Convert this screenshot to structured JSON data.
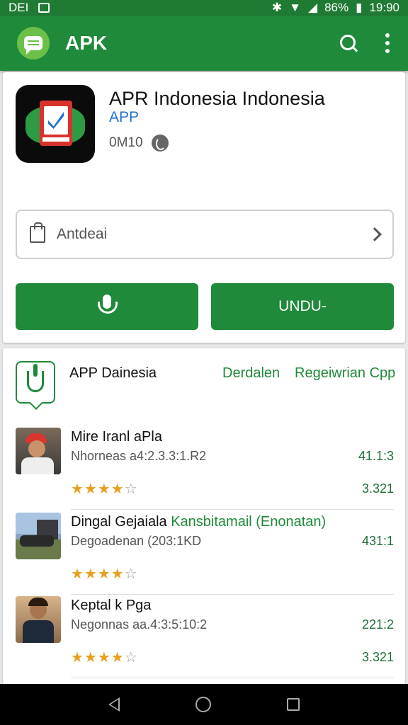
{
  "status_bar": {
    "left_text": "DEI",
    "battery": "86%",
    "time": "19:90"
  },
  "app_bar": {
    "title": "APK"
  },
  "app": {
    "name": "APR Indonesia Indonesia",
    "subtitle": "APP",
    "meta": "0M10",
    "dropdown_label": "Antdeai",
    "download_label": "UNDU-"
  },
  "section": {
    "title": "APP Dainesia",
    "link1": "Derdalen",
    "link2": "Regeiwrian Cpp"
  },
  "items": [
    {
      "name": "Mire Iranl aPla",
      "desc": "Nhorneas a4:2.3.3:1.R2",
      "value1": "41.1:3",
      "value2": "3.321",
      "rating": 4
    },
    {
      "name": "Dingal Gejaiala",
      "name_highlight": "Kansbitamail (Enonatan)",
      "desc": "Degoadenan (203:1KD",
      "value1": "431:1",
      "rating": 4
    },
    {
      "name": "Keptal k Pga",
      "desc": "Negonnas aa.4:3:5:10:2",
      "value1": "221:2",
      "value2": "3.321",
      "rating": 4
    }
  ],
  "colors": {
    "primary": "#1f8a3a",
    "accent_blue": "#1f6fd1",
    "star": "#e6a020"
  }
}
